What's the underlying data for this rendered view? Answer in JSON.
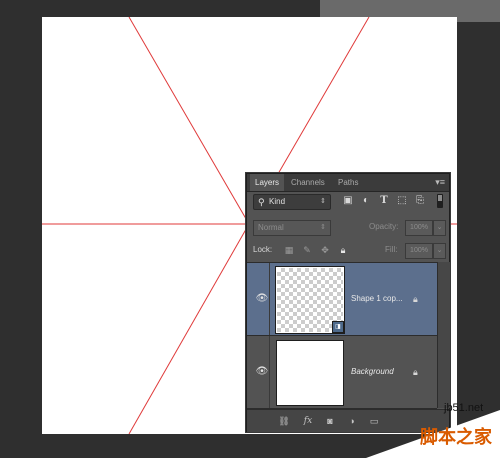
{
  "panel": {
    "tabs": [
      "Layers",
      "Channels",
      "Paths"
    ],
    "menu_icon": "panel-menu-icon",
    "filter": {
      "kind_label": "Kind",
      "search_icon": "search-icon"
    },
    "blend": {
      "mode": "Normal",
      "opacity_label": "Opacity:",
      "opacity_value": "100%"
    },
    "lock": {
      "label": "Lock:",
      "fill_label": "Fill:",
      "fill_value": "100%"
    },
    "layers": [
      {
        "name": "Shape 1 cop...",
        "selected": true,
        "thumbnail": "transparent"
      },
      {
        "name": "Background",
        "selected": false,
        "thumbnail": "white"
      }
    ]
  },
  "watermark": {
    "site": "jb51.net",
    "name": "脚本之家"
  },
  "colors": {
    "guide": "#e03a3a",
    "panel": "#535353",
    "selected_layer": "#5c6f8d",
    "workspace": "#323232",
    "document": "#ffffff"
  }
}
